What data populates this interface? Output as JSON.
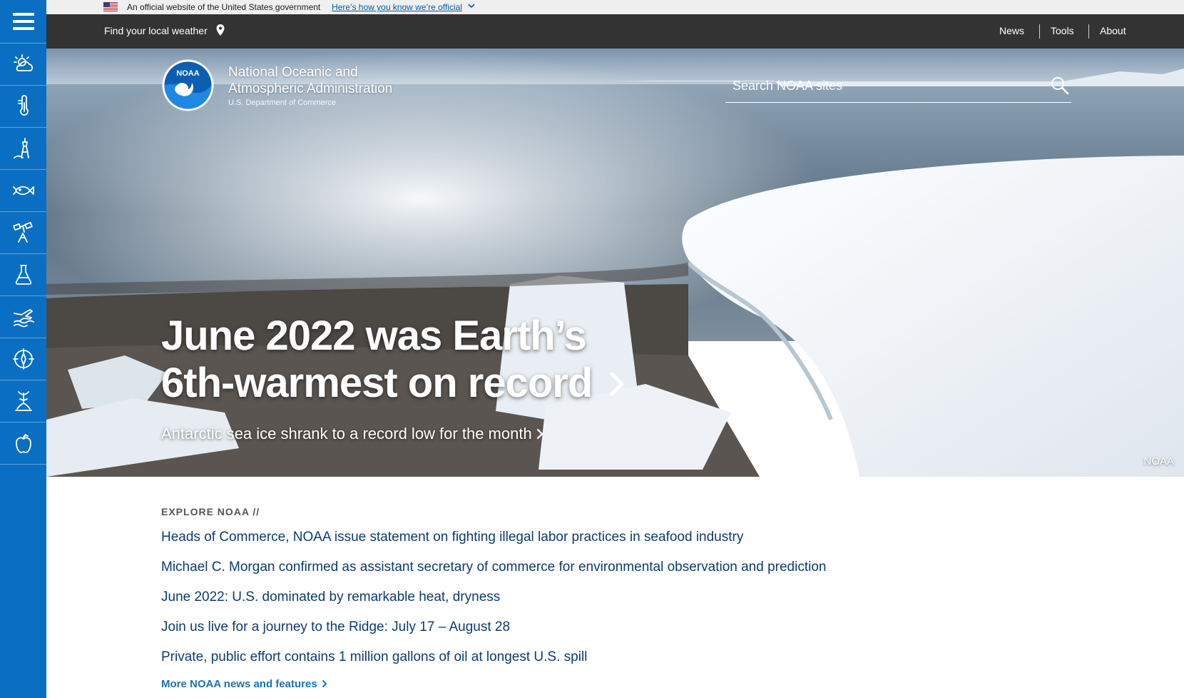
{
  "gov_banner": {
    "text": "An official website of the United States government",
    "link": "Here’s how you know we’re official"
  },
  "topnav": {
    "weather": "Find your local weather",
    "links": [
      "News",
      "Tools",
      "About"
    ]
  },
  "sidebar": {
    "items": [
      "weather-icon",
      "climate-icon",
      "ocean-coasts-icon",
      "fisheries-icon",
      "satellites-icon",
      "research-icon",
      "marine-aviation-icon",
      "charting-icon",
      "sanctuaries-icon",
      "education-icon"
    ]
  },
  "hero": {
    "org_line1": "National Oceanic and",
    "org_line2": "Atmospheric Administration",
    "org_dept": "U.S. Department of Commerce",
    "search_placeholder": "Search NOAA sites",
    "headline_line1": "June 2022 was Earth’s",
    "headline_line2": "6th-warmest on record",
    "subhead": "Antarctic sea ice shrank to a record low for the month",
    "credit": "NOAA"
  },
  "explore": {
    "title": "EXPLORE NOAA //",
    "links": [
      "Heads of Commerce, NOAA issue statement on fighting illegal labor practices in seafood industry",
      "Michael C. Morgan confirmed as assistant secretary of commerce for environmental observation and prediction",
      "June 2022: U.S. dominated by remarkable heat, dryness",
      "Join us live for a journey to the Ridge: July 17 – August 28",
      "Private, public effort contains 1 million gallons of oil at longest U.S. spill"
    ],
    "more": "More NOAA news and features"
  },
  "colors": {
    "sidebar": "#0a6fc2",
    "topnav": "#333333",
    "link": "#0d3b73",
    "more_link": "#1a71b8"
  }
}
